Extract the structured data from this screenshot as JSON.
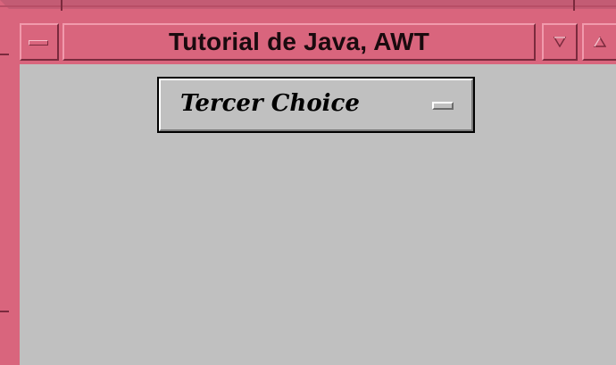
{
  "window": {
    "title": "Tutorial de Java, AWT",
    "frame_color": "#d9657d",
    "client_color": "#c0c0c0"
  },
  "controls": {
    "menu_icon": "window-menu-icon",
    "minimize_icon": "minimize-icon",
    "maximize_icon": "maximize-icon"
  },
  "choice": {
    "selected": "Tercer Choice",
    "indicator_icon": "option-menu-indicator-icon"
  }
}
